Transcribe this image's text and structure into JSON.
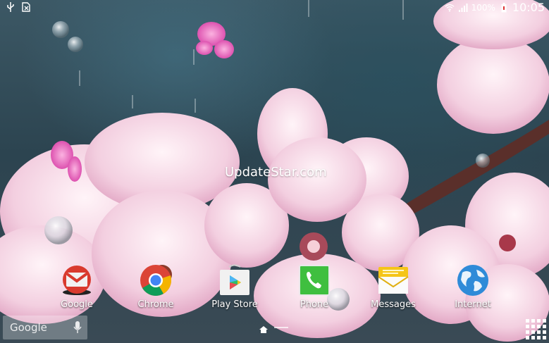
{
  "status_bar": {
    "left_icons": [
      "usb-icon",
      "sim-card-icon"
    ],
    "right_icons": [
      "wifi-icon",
      "signal-icon",
      "battery-icon"
    ],
    "battery_percent": "100%",
    "time": "10:05"
  },
  "watermark": "UpdateStar.com",
  "dock": {
    "apps": [
      {
        "label": "Google",
        "icon": "gmail-icon"
      },
      {
        "label": "Chrome",
        "icon": "chrome-icon"
      },
      {
        "label": "Play Store",
        "icon": "play-store-icon"
      },
      {
        "label": "Phone",
        "icon": "phone-icon"
      },
      {
        "label": "Messages",
        "icon": "messages-icon"
      },
      {
        "label": "Internet",
        "icon": "globe-icon"
      }
    ]
  },
  "search_widget": {
    "logo_text": "Google"
  },
  "colors": {
    "petal": "#f3c9dc",
    "petal_shade": "#e7a8c6",
    "phone_green": "#3fbf3f",
    "messages_yellow": "#f5c518",
    "internet_blue": "#2f8bd8"
  }
}
